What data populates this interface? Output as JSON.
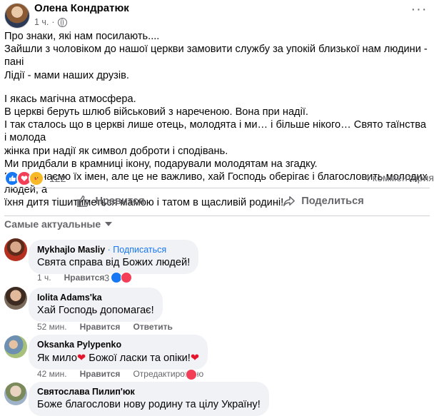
{
  "post": {
    "author": "Олена Кондратюк",
    "time": "1 ч.",
    "more_icon": "···",
    "paragraphs": [
      [
        "Про знаки, які нам посилають....",
        "Зайшли з чоловіком до нашої церкви замовити службу за упокій близької нам людини - пані",
        "Лідії - мами наших друзів."
      ],
      [
        "І якась магічна атмосфера.",
        "В церкві беруть шлюб військовий з нареченою. Вона при надії.",
        "І так сталось що в церкві лише отець, молодята і ми… і більше нікого… Свято таїнства і молода",
        "жінка при надії як символ доброти і сподівань.",
        "Ми придбали в крамниці ікону, подарували молодятам на згадку.",
        "Ми не знаємо їх імен, але це не важливо, хай Господь оберігає і благословить молодих людей, а",
        "їхня дитя тішитиметься мамою і татом в щасливій родині!"
      ]
    ],
    "reaction_count": "122",
    "comments_count": "4 комментария",
    "like_label": "Нравится",
    "share_label": "Поделиться",
    "sort_label": "Самые актуальные"
  },
  "comments": [
    {
      "name": "Mykhajlo Masliy",
      "extra": " · Подписаться",
      "text": "Свята справа від Божих людей!",
      "time": "1 ч.",
      "like": "Нравится",
      "reply": "",
      "count": "3"
    },
    {
      "name": "Iolita Adams'ka",
      "extra": "",
      "text": "Хай Господь допомагає!",
      "time": "52 мин.",
      "like": "Нравится",
      "reply": "Ответить"
    },
    {
      "name": "Oksanka Pylypenko",
      "extra": "",
      "text_a": "Як мило",
      "text_b": " Божої ласки та опіки!",
      "time": "42 мин.",
      "like": "Нравится",
      "reply": "Отредактировано"
    },
    {
      "name": "Святослава Пилип'юк",
      "extra": "",
      "text": "Боже благослови нову родину та цілу Україну!"
    }
  ],
  "colors": {
    "accent": "#1877f2",
    "love": "#f33e58",
    "muted": "#65676b"
  }
}
